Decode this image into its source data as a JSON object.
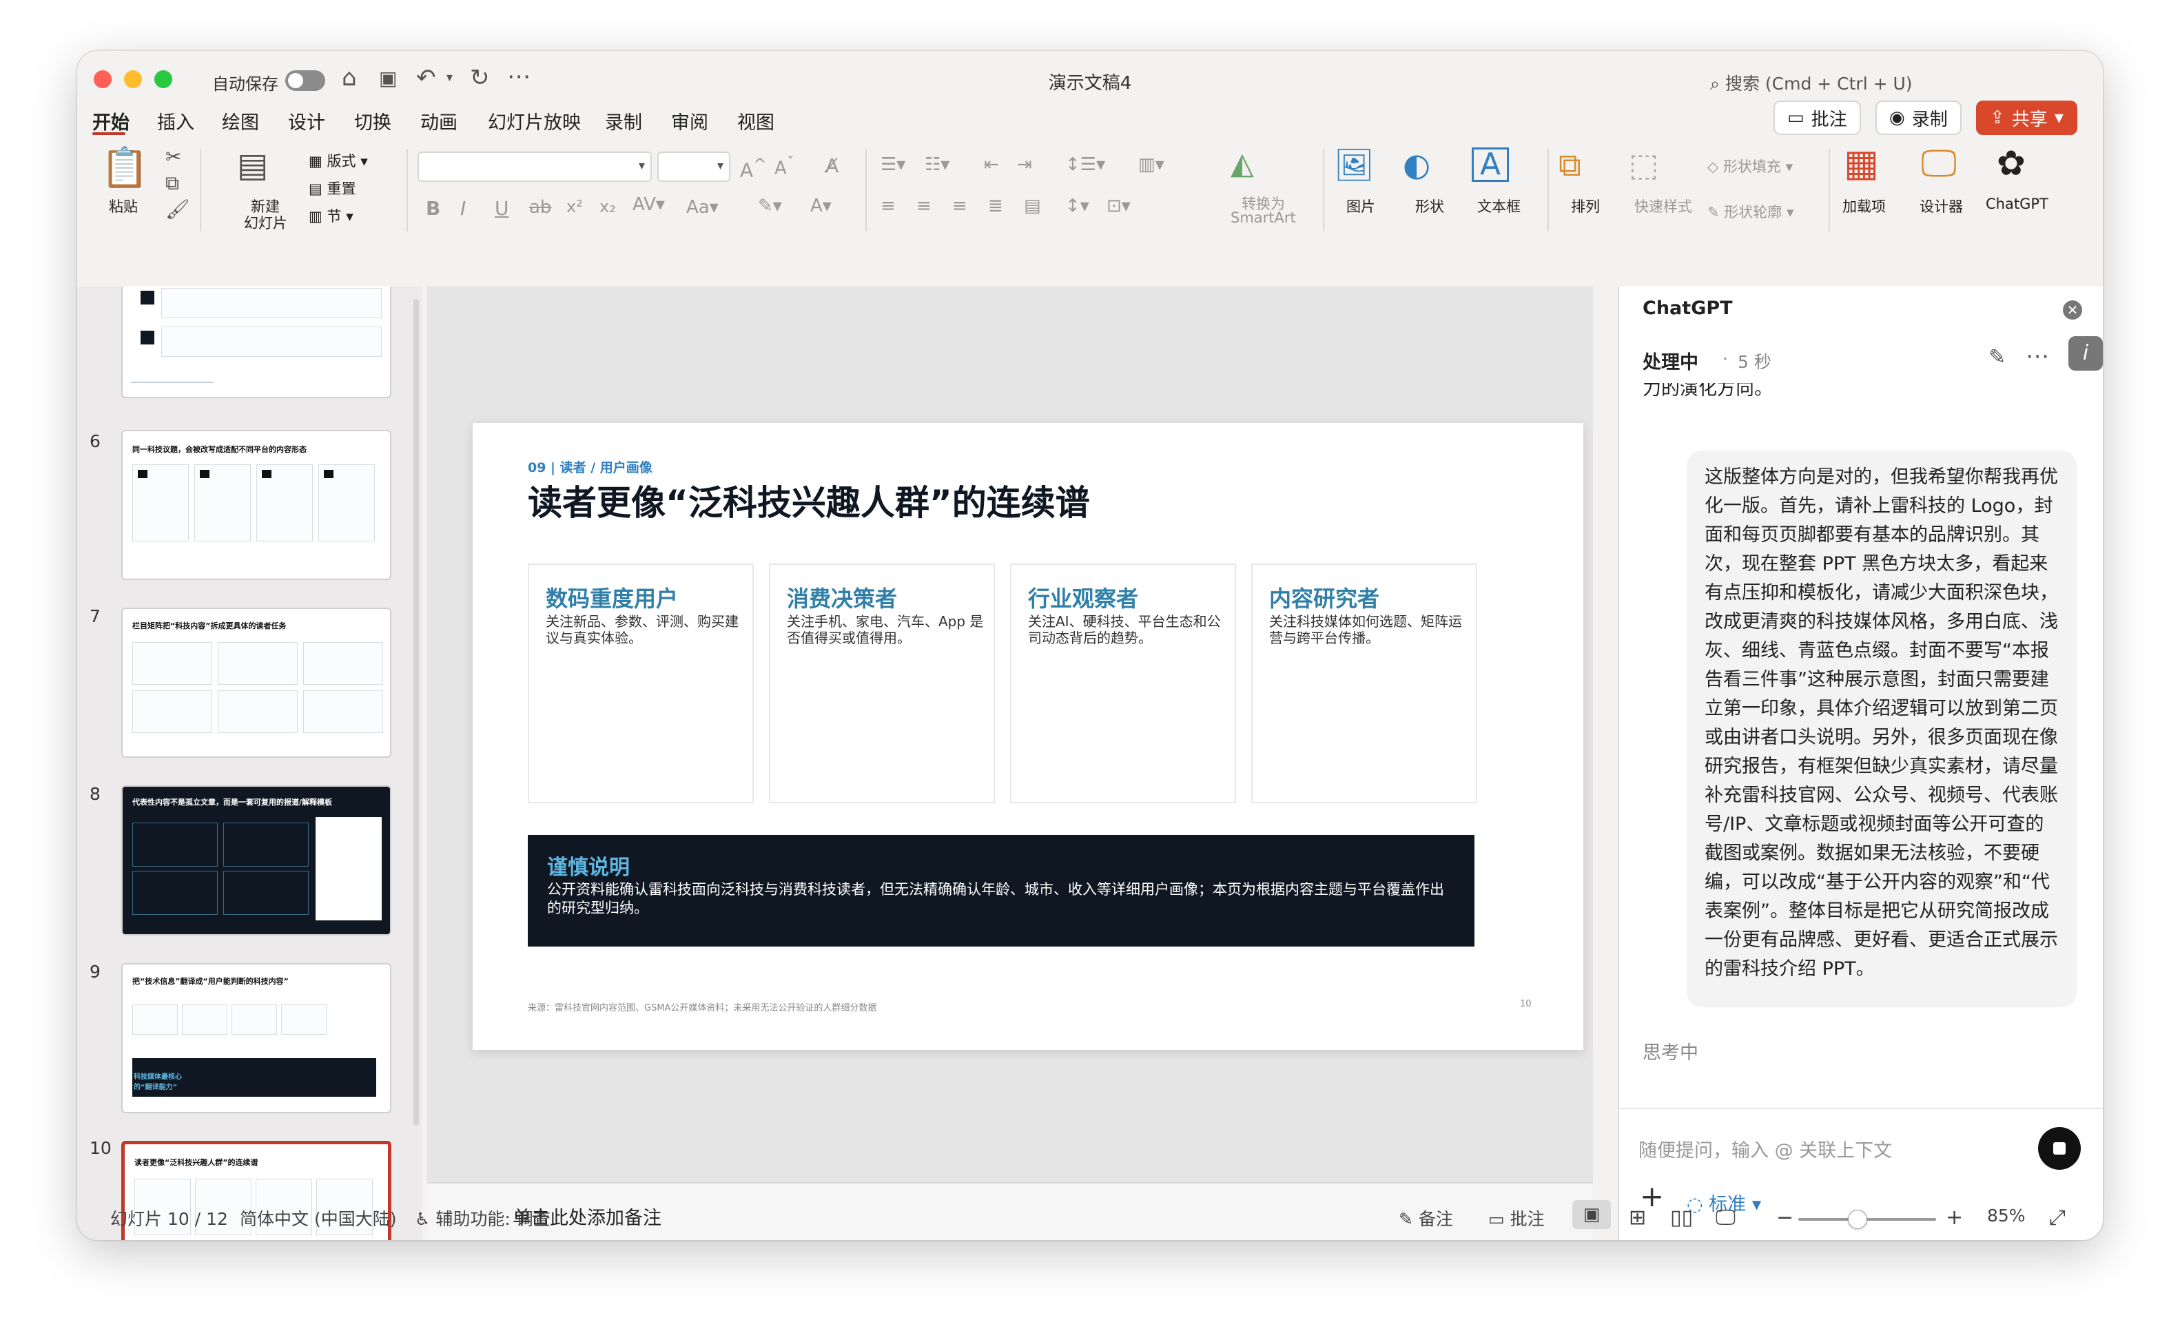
{
  "window": {
    "autosave_label": "自动保存",
    "doc_title": "演示文稿4",
    "search_placeholder": "搜索 (Cmd + Ctrl + U)"
  },
  "menu": [
    "开始",
    "插入",
    "绘图",
    "设计",
    "切换",
    "动画",
    "幻灯片放映",
    "录制",
    "审阅",
    "视图"
  ],
  "toolbar_right": {
    "comment": "批注",
    "record": "录制",
    "share": "共享"
  },
  "ribbon": {
    "paste": "粘贴",
    "new_slide_1": "新建",
    "new_slide_2": "幻灯片",
    "layout": "版式",
    "reset": "重置",
    "section": "节",
    "font_name": "",
    "font_size": "",
    "convert_smartart_1": "转换为",
    "convert_smartart_2": "SmartArt",
    "picture": "图片",
    "shape": "形状",
    "textbox": "文本框",
    "arrange": "排列",
    "quick_styles": "快速样式",
    "shape_fill": "形状填充",
    "shape_outline": "形状轮廓",
    "addins": "加载项",
    "designer": "设计器",
    "chatgpt": "ChatGPT"
  },
  "thumbnails": [
    {
      "num": "",
      "title": ""
    },
    {
      "num": "6",
      "title": "同一科技议题，会被改写成适配不同平台的内容形态"
    },
    {
      "num": "7",
      "title": "栏目矩阵把“科技内容”拆成更具体的读者任务"
    },
    {
      "num": "8",
      "title": "代表性内容不是孤立文章，而是一套可复用的报道/解释模板"
    },
    {
      "num": "9",
      "title": "把“技术信息”翻译成“用户能判断的科技内容”"
    },
    {
      "num": "10",
      "title": "读者更像“泛科技兴趣人群”的连续谱"
    }
  ],
  "thumb9_band": "科技媒体最核心的“翻译能力”",
  "slide": {
    "tag": "09 | 读者 / 用户画像",
    "title": "读者更像“泛科技兴趣人群”的连续谱",
    "cards": [
      {
        "title": "数码重度用户",
        "desc": "关注新品、参数、评测、购买建议与真实体验。"
      },
      {
        "title": "消费决策者",
        "desc": "关注手机、家电、汽车、App 是否值得买或值得用。"
      },
      {
        "title": "行业观察者",
        "desc": "关注AI、硬科技、平台生态和公司动态背后的趋势。"
      },
      {
        "title": "内容研究者",
        "desc": "关注科技媒体如何选题、矩阵运营与跨平台传播。"
      }
    ],
    "note_title": "谨慎说明",
    "note_text": "公开资料能确认雷科技面向泛科技与消费科技读者，但无法精确确认年龄、城市、收入等详细用户画像；本页为根据内容主题与平台覆盖作出的研究型归纳。",
    "source": "来源：雷科技官网内容范围、GSMA公开媒体资料；未采用无法公开验证的人群细分数据",
    "page_num": "10"
  },
  "notes_placeholder": "单击此处添加备注",
  "chat": {
    "title": "ChatGPT",
    "status": "处理中",
    "elapsed": "5 秒",
    "cut_text": "力的演化方向。",
    "user_message": "这版整体方向是对的，但我希望你帮我再优化一版。首先，请补上雷科技的 Logo，封面和每页页脚都要有基本的品牌识别。其次，现在整套 PPT 黑色方块太多，看起来有点压抑和模板化，请减少大面积深色块，改成更清爽的科技媒体风格，多用白底、浅灰、细线、青蓝色点缀。封面不要写“本报告看三件事”这种展示意图，封面只需要建立第一印象，具体介绍逻辑可以放到第二页或由讲者口头说明。另外，很多页面现在像研究报告，有框架但缺少真实素材，请尽量补充雷科技官网、公众号、视频号、代表账号/IP、文章标题或视频封面等公开可查的截图或案例。数据如果无法核验，不要硬编，可以改成“基于公开内容的观察”和“代表案例”。整体目标是把它从研究简报改成一份更有品牌感、更好看、更适合正式展示的雷科技介绍 PPT。",
    "thinking": "思考中",
    "input_placeholder": "随便提问，输入 @ 关联上下文",
    "mode": "标准"
  },
  "statusbar": {
    "slide_info": "幻灯片 10 / 12",
    "language": "简体中文 (中国大陆)",
    "accessibility": "辅助功能: 调查",
    "notes": "备注",
    "comments": "批注",
    "zoom": "85%"
  },
  "zoom_level": 0.85,
  "colors": {
    "accent": "#c0392b",
    "share": "#d9482b",
    "dark_slide": "#0f1722",
    "card_title": "#2f7fa8"
  }
}
